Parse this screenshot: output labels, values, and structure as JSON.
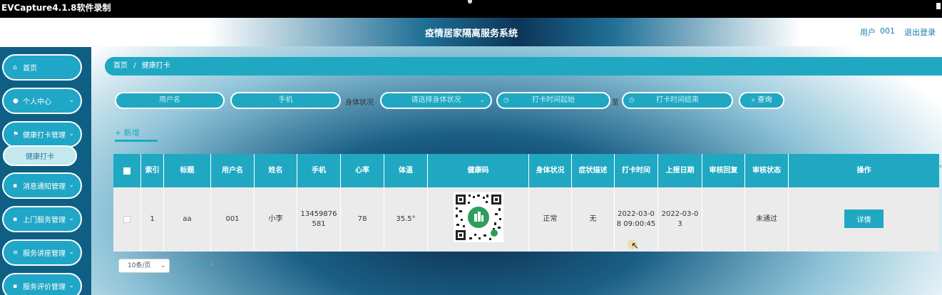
{
  "recorder": {
    "title": "EVCapture4.1.8软件录制"
  },
  "header": {
    "title": "疫情居家隔离服务系统",
    "user_label": "用户",
    "user_value": "001",
    "logout": "退出登录"
  },
  "sidebar": {
    "items": [
      {
        "icon": "home-icon",
        "glyph": "⌂",
        "label": "首页",
        "chevron": ""
      },
      {
        "icon": "user-icon",
        "glyph": "●",
        "label": "个人中心",
        "chevron": "⌄"
      },
      {
        "icon": "flag-icon",
        "glyph": "⚑",
        "label": "健康打卡管理",
        "chevron": "⌄"
      },
      {
        "icon": "grid-icon",
        "glyph": "▪",
        "label": "消息通知管理",
        "chevron": "⌄"
      },
      {
        "icon": "grid-icon",
        "glyph": "▪",
        "label": "上门服务管理",
        "chevron": "⌄"
      },
      {
        "icon": "menu-icon",
        "glyph": "≡",
        "label": "服务讲座管理",
        "chevron": "⌄"
      },
      {
        "icon": "grid-icon",
        "glyph": "▪",
        "label": "服务评价管理",
        "chevron": "⌄"
      }
    ],
    "subitem": "健康打卡"
  },
  "breadcrumb": {
    "home": "首页",
    "sep": "/",
    "current": "健康打卡"
  },
  "filters": {
    "username_placeholder": "用户名",
    "phone_placeholder": "手机",
    "status_label": "身体状况",
    "status_placeholder": "请选择身体状况",
    "time_start_placeholder": "打卡时间起始",
    "to_label": "至",
    "time_end_placeholder": "打卡时间结束",
    "search_label": "查询"
  },
  "actions": {
    "add_label": "+ 新增"
  },
  "table": {
    "headers": [
      "",
      "索引",
      "标题",
      "用户名",
      "姓名",
      "手机",
      "心率",
      "体温",
      "健康码",
      "身体状况",
      "症状描述",
      "打卡时间",
      "上报日期",
      "审核回复",
      "审核状态",
      "操作"
    ],
    "rows": [
      {
        "index": "1",
        "title": "aa",
        "username": "001",
        "name": "小李",
        "phone": "13459876581",
        "heart_rate": "78",
        "temperature": "35.5°",
        "health_code": "qr-code-image",
        "status": "正常",
        "symptom": "无",
        "checkin_time": "2022-03-08 09:00:45",
        "report_date": "2022-03-03",
        "review_reply": "",
        "review_status": "未通过",
        "detail_label": "详情"
      }
    ]
  },
  "pagination": {
    "page_size": "10条/页",
    "current_page": "1"
  },
  "colors": {
    "accent": "#20a8c3",
    "sidebar": "#0f5f85"
  }
}
